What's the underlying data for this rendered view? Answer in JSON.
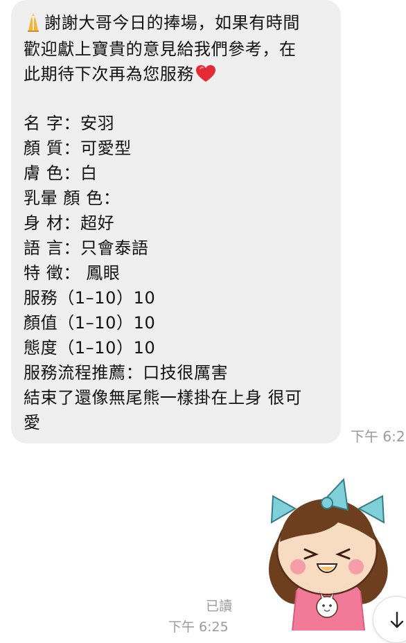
{
  "conversation": {
    "message": {
      "line1": "謝謝大哥今日的捧場，如果有時間",
      "line2": "歡迎獻上寶貴的意見給我們參考，在",
      "line3": "此期待下次再為您服務",
      "line4": "名 字：安羽",
      "line5": "顏 質：可愛型",
      "line6": "膚 色：白",
      "line7": "乳暈 顏 色：",
      "line8": "身 材：超好",
      "line9": "語 言：只會泰語",
      "line10": "特 徵： 鳳眼",
      "line11": "服務（1–10）10",
      "line12": "顏值（1–10）10",
      "line13": "態度（1–10）10",
      "line14": "服務流程推薦：口技很厲害",
      "line15": "結束了還像無尾熊一樣掛在上身 很可",
      "line16": "愛"
    },
    "incoming_time": "下午 6:2",
    "read_label": "已讀",
    "sent_time": "下午 6:25",
    "colors": {
      "bubble": "#efefef",
      "timestamp": "#9a9a9a"
    },
    "icons": {
      "prayer": "folded-hands-emoji",
      "heart": "red-heart-emoji",
      "scroll": "arrow-down-icon"
    }
  }
}
